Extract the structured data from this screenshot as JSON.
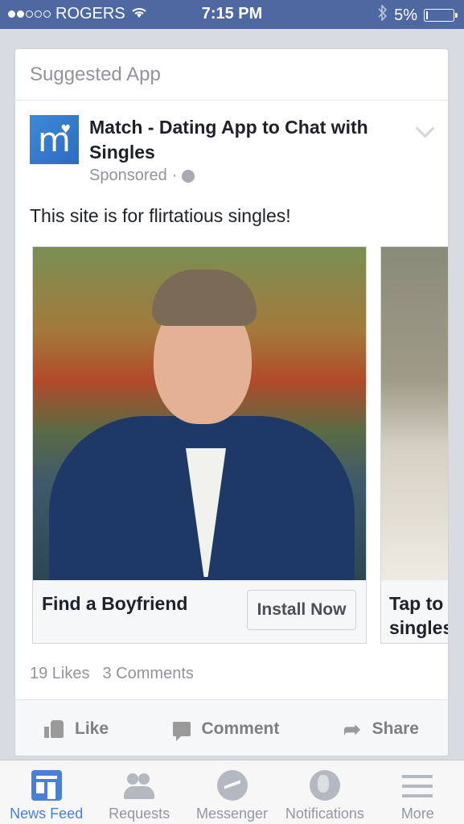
{
  "status_bar": {
    "carrier": "ROGERS",
    "time": "7:15 PM",
    "battery": "5%",
    "battery_level": 0.05,
    "signal_bars_filled": 2,
    "signal_bars_total": 5
  },
  "card": {
    "header": "Suggested App",
    "app_title": "Match - Dating App to Chat with Singles",
    "sponsored": "Sponsored",
    "message": "This site is for flirtatious singles!",
    "carousel": [
      {
        "caption": "Find a Boyfriend",
        "button": "Install Now"
      },
      {
        "caption": "Tap to view of singles"
      }
    ],
    "stats": {
      "likes": "19 Likes",
      "comments": "3 Comments"
    },
    "actions": {
      "like": "Like",
      "comment": "Comment",
      "share": "Share"
    }
  },
  "tabbar": {
    "tabs": [
      {
        "label": "News Feed",
        "icon": "news-feed-icon",
        "active": true
      },
      {
        "label": "Requests",
        "icon": "friend-requests-icon",
        "active": false
      },
      {
        "label": "Messenger",
        "icon": "messenger-icon",
        "active": false
      },
      {
        "label": "Notifications",
        "icon": "globe-icon",
        "active": false
      },
      {
        "label": "More",
        "icon": "menu-icon",
        "active": false
      }
    ]
  },
  "colors": {
    "status_bar_bg": "#4e69a2",
    "active_tab": "#4a7fd8",
    "app_logo": "#3c8ad9"
  }
}
